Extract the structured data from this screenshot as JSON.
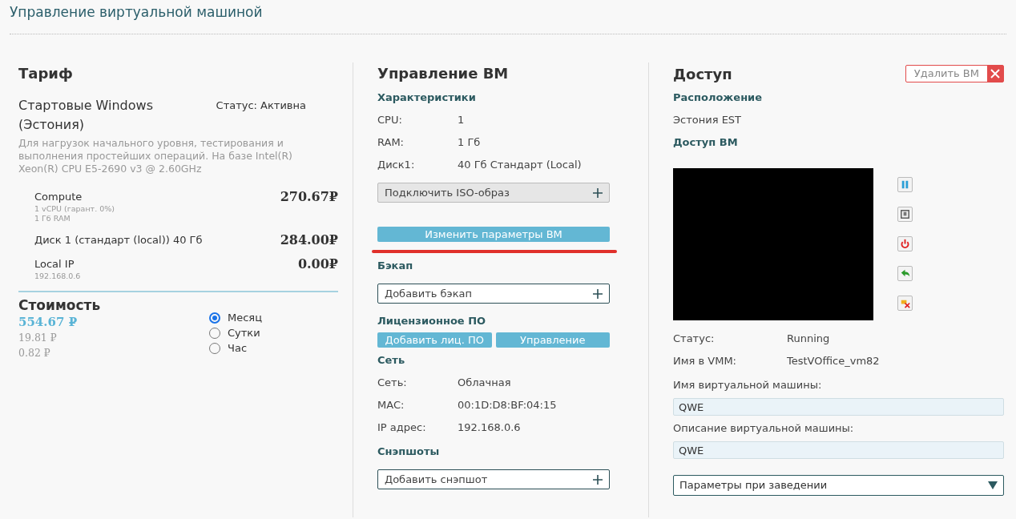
{
  "title": "Управление виртуальной машиной",
  "tariff": {
    "heading": "Тариф",
    "name": "Стартовые Windows (Эстония)",
    "status": "Статус: Активна",
    "description": "Для нагрузок начального уровня, тестирования и выполнения простейших операций. На базе Intel(R) Xeon(R) CPU E5-2690 v3 @ 2.60GHz",
    "items": [
      {
        "name": "Compute",
        "details": [
          "1 vCPU (гарант. 0%)",
          "1 Гб RAM"
        ],
        "price": "270.67₽"
      },
      {
        "name": "Диск 1 (стандарт (local)) 40 Гб",
        "price": "284.00₽"
      },
      {
        "name": "Local IP",
        "details": [
          "192.168.0.6"
        ],
        "price": "0.00₽"
      }
    ]
  },
  "cost": {
    "heading": "Стоимость",
    "amounts": [
      "554.67 ₽",
      "19.81 ₽",
      "0.82 ₽"
    ],
    "periods": [
      {
        "label": "Месяц",
        "selected": true
      },
      {
        "label": "Сутки",
        "selected": false
      },
      {
        "label": "Час",
        "selected": false
      }
    ]
  },
  "management": {
    "heading": "Управление ВМ",
    "blocks": [
      {
        "kind": "subheading",
        "text": "Характеристики"
      },
      {
        "kind": "row",
        "label": "CPU:",
        "value": "1"
      },
      {
        "kind": "row",
        "label": "RAM:",
        "value": "1 Гб"
      },
      {
        "kind": "row",
        "label": "Диск1:",
        "value": "40 Гб Стандарт (Local)"
      },
      {
        "kind": "add",
        "text": "Подключить ISO-образ",
        "disabled": true
      },
      {
        "kind": "primary",
        "text": "Изменить параметры ВМ",
        "underlined": true
      },
      {
        "kind": "subheading",
        "text": "Бэкап"
      },
      {
        "kind": "add",
        "text": "Добавить бэкап",
        "disabled": false
      },
      {
        "kind": "subheading",
        "text": "Лицензионное ПО"
      },
      {
        "kind": "pair",
        "texts": [
          "Добавить лиц. ПО",
          "Управление"
        ]
      },
      {
        "kind": "subheading",
        "text": "Сеть"
      },
      {
        "kind": "row",
        "label": "Сеть:",
        "value": "Облачная"
      },
      {
        "kind": "row",
        "label": "MAC:",
        "value": "00:1D:D8:BF:04:15"
      },
      {
        "kind": "row",
        "label": "IP адрес:",
        "value": "192.168.0.6"
      },
      {
        "kind": "subheading",
        "text": "Снэпшоты"
      },
      {
        "kind": "add",
        "text": "Добавить снэпшот",
        "disabled": false
      }
    ]
  },
  "access": {
    "heading": "Доступ",
    "delete_button": "Удалить ВМ",
    "location_heading": "Расположение",
    "location": "Эстония EST",
    "console_heading": "Доступ ВМ",
    "info": [
      {
        "label": "Статус:",
        "value": "Running"
      },
      {
        "label": "Имя в VMM:",
        "value": "TestVOffice_vm82"
      }
    ],
    "fields": [
      {
        "label": "Имя виртуальной машины:",
        "value": "QWE"
      },
      {
        "label": "Описание виртуальной машины:",
        "value": "QWE"
      }
    ],
    "dropdown": "Параметры при заведении"
  }
}
